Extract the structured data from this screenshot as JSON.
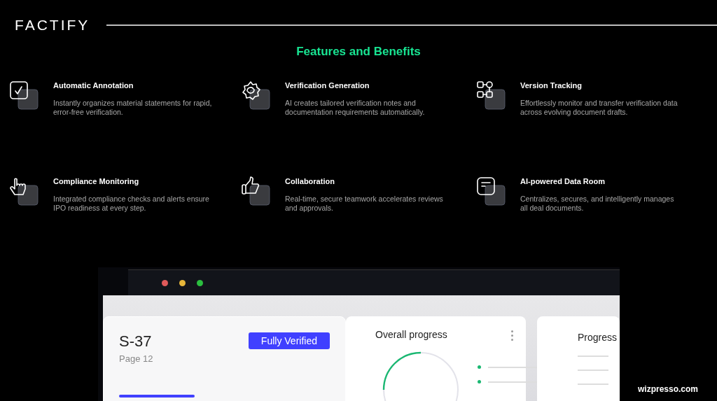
{
  "header": {
    "logo": "FACTIFY"
  },
  "title": "Features and Benefits",
  "features": [
    {
      "kind": "check",
      "title": "Automatic Annotation",
      "description": "Instantly organizes material statements for rapid, error-free verification."
    },
    {
      "kind": "gear",
      "title": "Verification Generation",
      "description": "AI creates tailored verification notes and documentation requirements automatically."
    },
    {
      "kind": "nodes",
      "title": "Version Tracking",
      "description": "Effortlessly monitor and transfer verification data across evolving document drafts."
    },
    {
      "kind": "pointer",
      "title": "Compliance Monitoring",
      "description": "Integrated compliance checks and alerts ensure IPO readiness at every step."
    },
    {
      "kind": "thumb",
      "title": "Collaboration",
      "description": "Real-time, secure teamwork accelerates reviews and approvals."
    },
    {
      "kind": "document",
      "title": "AI-powered Data Room",
      "description": "Centralizes, secures, and intelligently manages all deal documents."
    }
  ],
  "app_preview": {
    "window_dots": [
      {
        "color": "#e05a5a"
      },
      {
        "color": "#e6b63a"
      },
      {
        "color": "#2bbf3f"
      }
    ],
    "document_card": {
      "code": "S-37",
      "page": "Page 12",
      "badge": "Fully Verified"
    },
    "progress_card": {
      "title": "Overall progress"
    },
    "side_card": {
      "title": "Progress"
    }
  },
  "footer": "wizpresso.com"
}
